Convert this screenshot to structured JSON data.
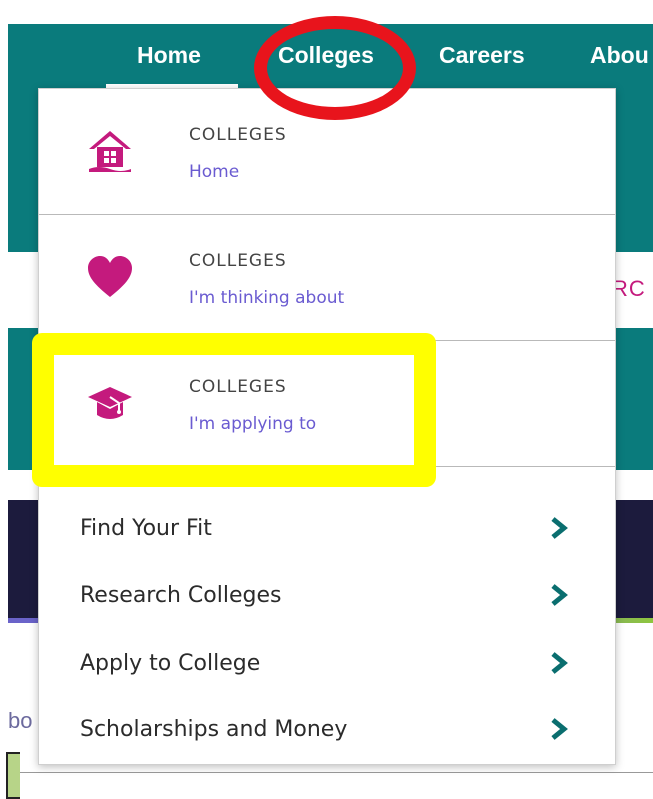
{
  "nav": {
    "items": [
      "Home",
      "Colleges",
      "Careers",
      "Abou"
    ]
  },
  "background": {
    "partial_text_right": "RC",
    "partial_text_left": "bo"
  },
  "dropdown": {
    "sections": [
      {
        "heading": "COLLEGES",
        "link": "Home",
        "icon": "house-icon"
      },
      {
        "heading": "COLLEGES",
        "link": "I'm thinking about",
        "icon": "heart-icon"
      },
      {
        "heading": "COLLEGES",
        "link": "I'm applying to",
        "icon": "graduation-cap-icon"
      }
    ],
    "menu": [
      {
        "label": "Find Your Fit"
      },
      {
        "label": "Research Colleges"
      },
      {
        "label": "Apply to College"
      },
      {
        "label": "Scholarships and Money"
      }
    ]
  },
  "colors": {
    "teal": "#0a7b7c",
    "magenta": "#c41a7d",
    "link_purple": "#6a5bd1",
    "annotation_red": "#e8141c",
    "annotation_yellow": "#ffff00"
  }
}
